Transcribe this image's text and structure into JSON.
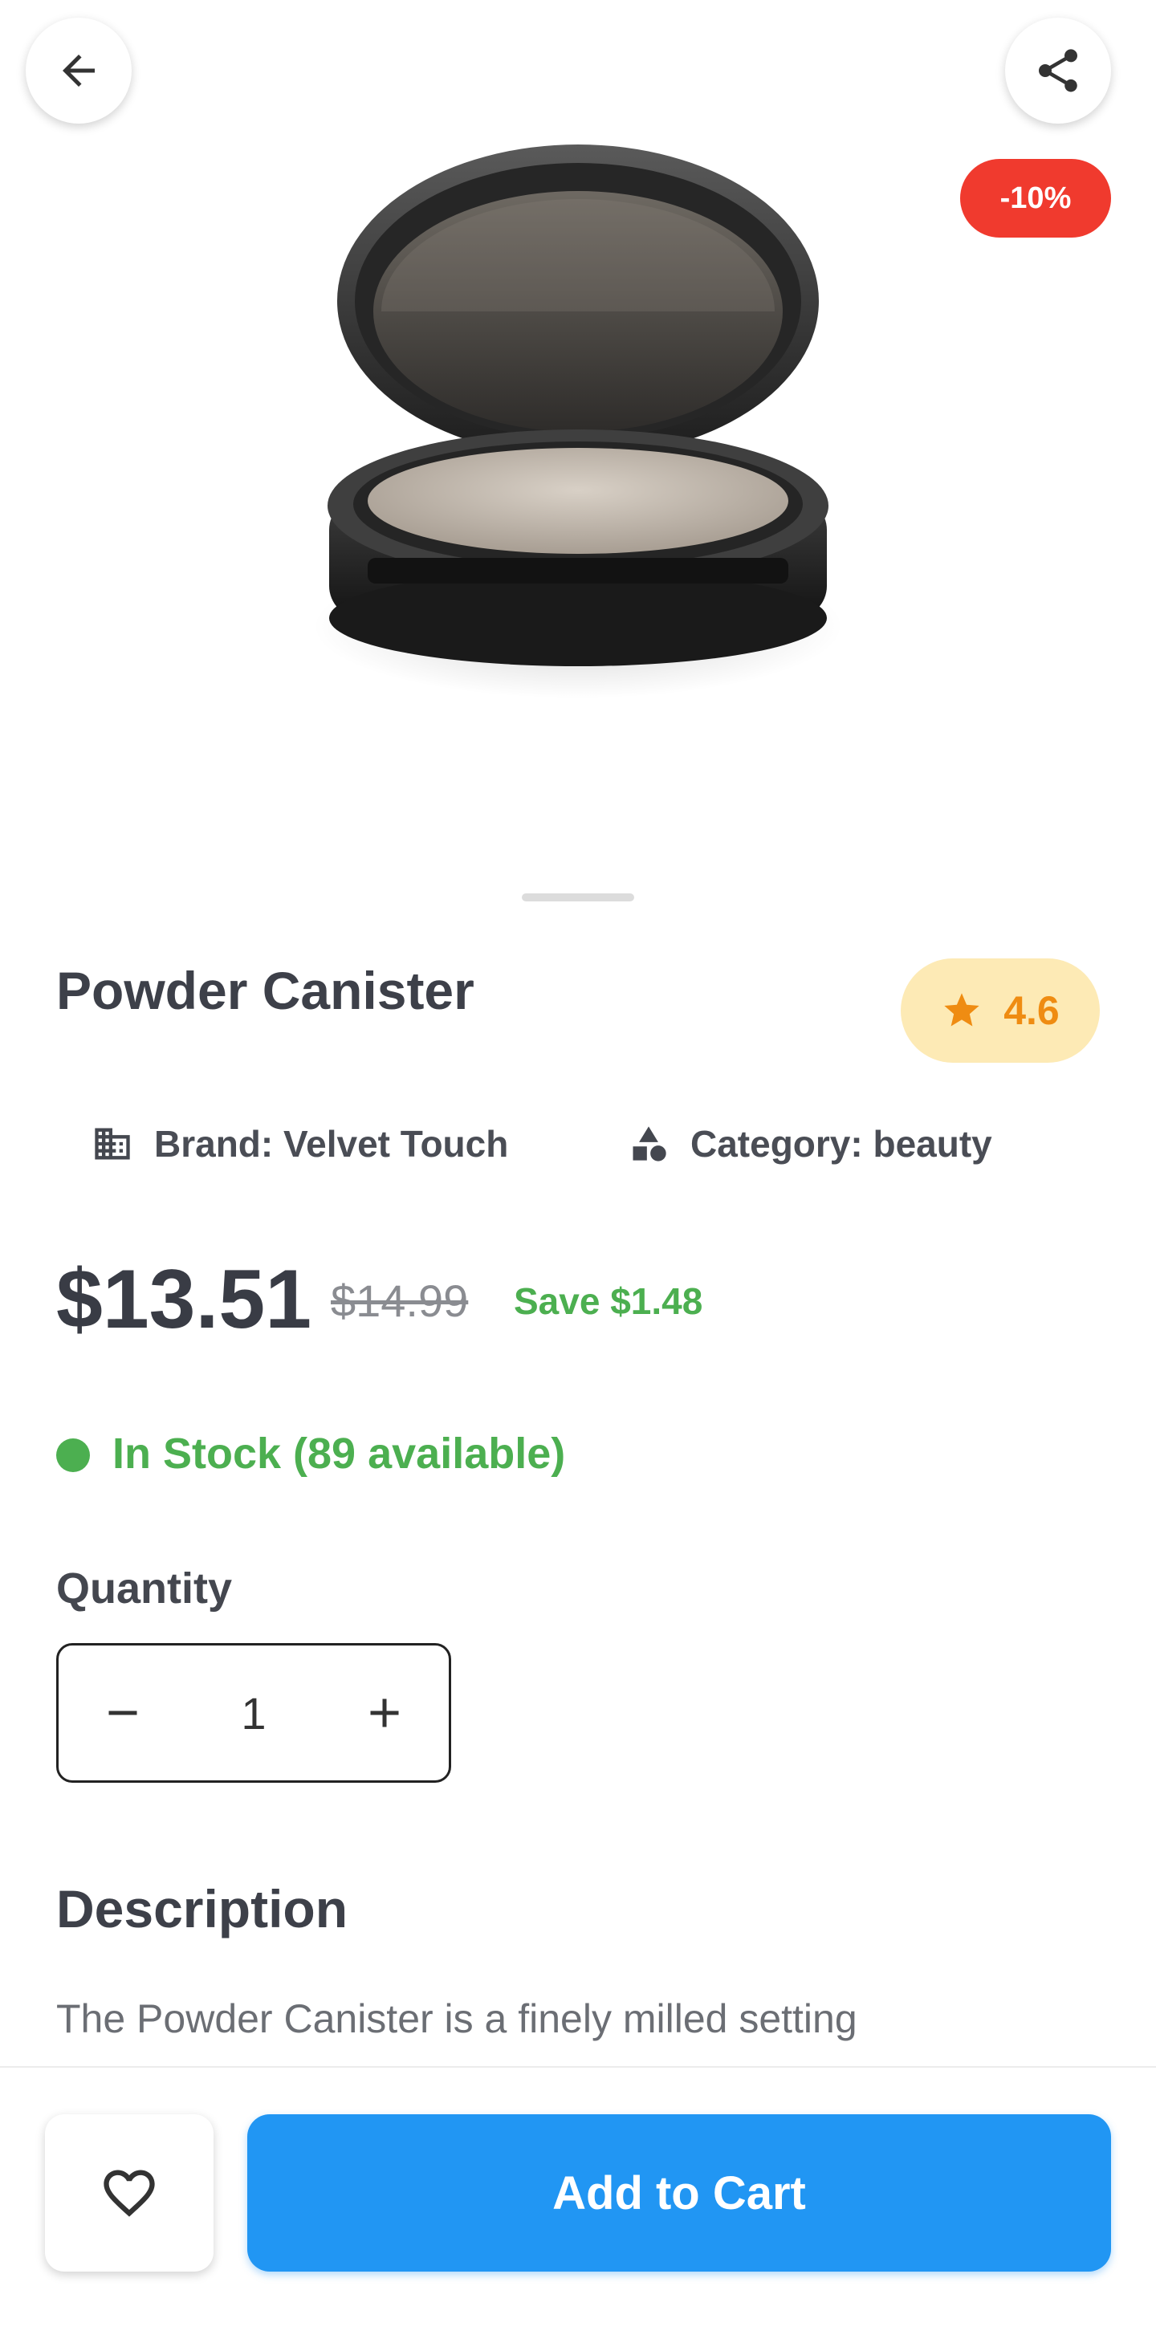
{
  "product": {
    "title": "Powder Canister",
    "discount_badge": "-10%",
    "rating": "4.6",
    "brand_text": "Brand: Velvet Touch",
    "category_text": "Category: beauty",
    "price": "$13.51",
    "original_price": "$14.99",
    "savings": "Save $1.48",
    "stock_status": "In Stock (89 available)"
  },
  "quantity": {
    "label": "Quantity",
    "value": "1"
  },
  "description": {
    "title": "Description",
    "text": "The Powder Canister is a finely milled setting"
  },
  "actions": {
    "add_to_cart": "Add to Cart"
  },
  "icons": {
    "back": "arrow-back-icon",
    "share": "share-icon",
    "star": "star-icon",
    "brand": "building-icon",
    "category": "category-shapes-icon",
    "minus": "minus-icon",
    "plus": "plus-icon",
    "favorite": "heart-outline-icon"
  },
  "colors": {
    "accent": "#2196f3",
    "discount": "#f03a2e",
    "success": "#4caf50",
    "rating": "#ef8c12",
    "rating_bg": "#fdeab5"
  }
}
